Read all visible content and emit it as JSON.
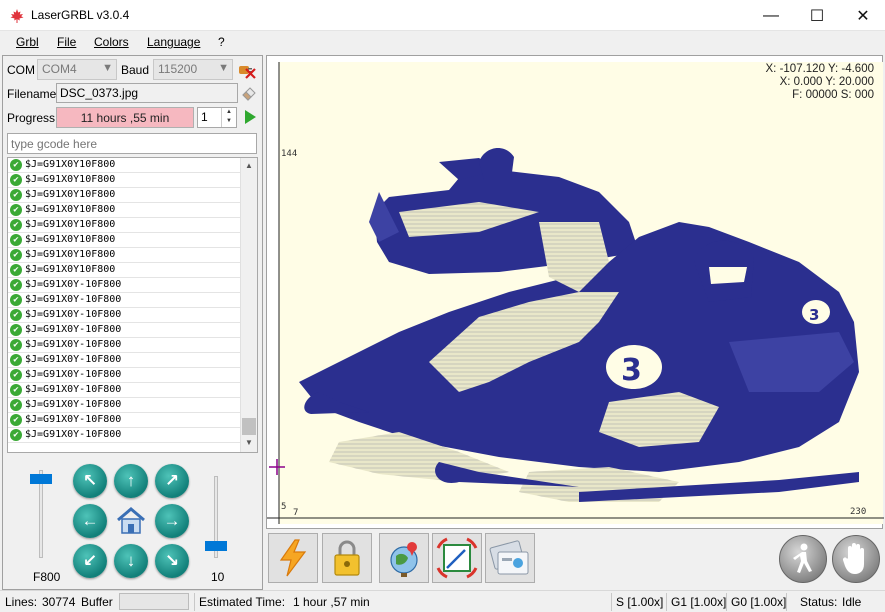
{
  "window": {
    "title": "LaserGRBL v3.0.4",
    "minimize": "—",
    "maximize": "☐",
    "close": "✕"
  },
  "menu": {
    "items": [
      {
        "label": "Grbl"
      },
      {
        "label": "File"
      },
      {
        "label": "Colors"
      },
      {
        "label": "Language"
      },
      {
        "label": "?"
      }
    ]
  },
  "connection": {
    "com_label": "COM",
    "com_value": "COM4",
    "baud_label": "Baud",
    "baud_value": "115200"
  },
  "file": {
    "filename_label": "Filename",
    "filename_value": "DSC_0373.jpg"
  },
  "progress": {
    "label": "Progress",
    "value": "11 hours ,55 min",
    "passes": "1"
  },
  "gcode_input": {
    "placeholder": "type gcode here"
  },
  "gcode_log": [
    "$J=G91X0Y10F800",
    "$J=G91X0Y10F800",
    "$J=G91X0Y10F800",
    "$J=G91X0Y10F800",
    "$J=G91X0Y10F800",
    "$J=G91X0Y10F800",
    "$J=G91X0Y10F800",
    "$J=G91X0Y10F800",
    "$J=G91X0Y-10F800",
    "$J=G91X0Y-10F800",
    "$J=G91X0Y-10F800",
    "$J=G91X0Y-10F800",
    "$J=G91X0Y-10F800",
    "$J=G91X0Y-10F800",
    "$J=G91X0Y-10F800",
    "$J=G91X0Y-10F800",
    "$J=G91X0Y-10F800",
    "$J=G91X0Y-10F800",
    "$J=G91X0Y-10F800"
  ],
  "jog": {
    "speed_label": "F800",
    "step_label": "10",
    "speed_level": 0.95,
    "step_level": 0.1,
    "arrows": {
      "up_left": "↖",
      "up": "↑",
      "up_right": "↗",
      "left": "←",
      "right": "→",
      "down_left": "↙",
      "down": "↓",
      "down_right": "↘"
    }
  },
  "preview": {
    "coords_line1": "X: -107.120 Y: -4.600",
    "coords_line2": "X: 0.000 Y: 20.000",
    "coords_line3": "F: 00000 S: 000",
    "y_max_label": "144",
    "y_min_label": "5",
    "x_min_label": "7",
    "x_max_label": "230"
  },
  "statusbar": {
    "lines_label": "Lines:",
    "lines_value": "30774",
    "buffer_label": "Buffer",
    "estimated_label": "Estimated Time:",
    "estimated_value": "1 hour ,57 min",
    "s_override": "S [1.00x]",
    "g1_override": "G1 [1.00x]",
    "g0_override": "G0 [1.00x]",
    "status_label": "Status:",
    "status_value": "Idle"
  },
  "icons": {
    "app": "maple-leaf-icon",
    "disconnect": "plug-disconnect-icon",
    "open_file": "eraser-icon",
    "run": "play-icon",
    "home": "home-icon",
    "toolbar": [
      "lightning-icon",
      "padlock-icon",
      "globe-pin-icon",
      "frame-corners-icon",
      "photo-card-icon",
      "walking-man-icon",
      "stop-hand-icon"
    ]
  },
  "colors": {
    "accent": "#0078d7",
    "progress_bg": "#f6b8c0",
    "canvas_bg": "#fffde6",
    "engrave_blue": "#2b2f8f",
    "jog_teal": "#1a9a90"
  }
}
